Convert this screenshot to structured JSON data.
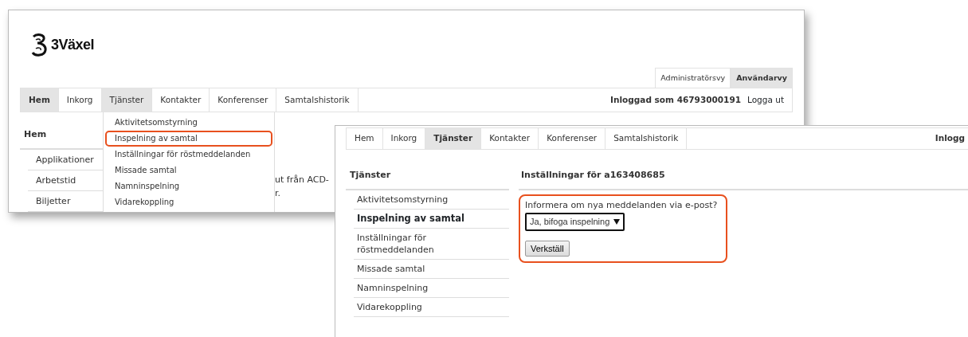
{
  "back_screenshot": {
    "logo": "3Växel",
    "view_tabs": [
      {
        "label": "Administratörsvy",
        "selected": false
      },
      {
        "label": "Användarvy",
        "selected": true
      }
    ],
    "nav": [
      {
        "label": "Hem",
        "selected": true,
        "open": false
      },
      {
        "label": "Inkorg",
        "selected": false,
        "open": false
      },
      {
        "label": "Tjänster",
        "selected": false,
        "open": true
      },
      {
        "label": "Kontakter",
        "selected": false,
        "open": false
      },
      {
        "label": "Konferenser",
        "selected": false,
        "open": false
      },
      {
        "label": "Samtalshistorik",
        "selected": false,
        "open": false
      }
    ],
    "logged_in": "Inloggad som 46793000191",
    "logout": "Logga ut",
    "sidebar": {
      "title": "Hem",
      "items": [
        "Applikationer",
        "Arbetstid",
        "Biljetter"
      ]
    },
    "dropdown": [
      {
        "label": "Aktivitetsomstyrning",
        "highlighted": false
      },
      {
        "label": "Inspelning av samtal",
        "highlighted": true
      },
      {
        "label": "Inställningar för röstmeddelanden",
        "highlighted": false
      },
      {
        "label": "Missade samtal",
        "highlighted": false
      },
      {
        "label": "Namninspelning",
        "highlighted": false
      },
      {
        "label": "Vidarekoppling",
        "highlighted": false
      }
    ],
    "content_fragments": [
      "ut från ACD-",
      "r."
    ]
  },
  "front_screenshot": {
    "nav": [
      {
        "label": "Hem",
        "selected": false
      },
      {
        "label": "Inkorg",
        "selected": false
      },
      {
        "label": "Tjänster",
        "selected": true
      },
      {
        "label": "Kontakter",
        "selected": false
      },
      {
        "label": "Konferenser",
        "selected": false
      },
      {
        "label": "Samtalshistorik",
        "selected": false
      }
    ],
    "logged_in": "Inlogg",
    "sidebar": {
      "title": "Tjänster",
      "items": [
        {
          "label": "Aktivitetsomstyrning",
          "selected": false
        },
        {
          "label": "Inspelning av samtal",
          "selected": true
        },
        {
          "label": "Inställningar för röstmeddelanden",
          "selected": false
        },
        {
          "label": "Missade samtal",
          "selected": false
        },
        {
          "label": "Namninspelning",
          "selected": false
        },
        {
          "label": "Vidarekoppling",
          "selected": false
        }
      ]
    },
    "main": {
      "title": "Inställningar för a163408685",
      "form": {
        "highlighted": true,
        "question": "Informera om nya meddelanden via e-post?",
        "select_value": "Ja, bifoga inspelning",
        "button": "Verkställ"
      }
    }
  }
}
